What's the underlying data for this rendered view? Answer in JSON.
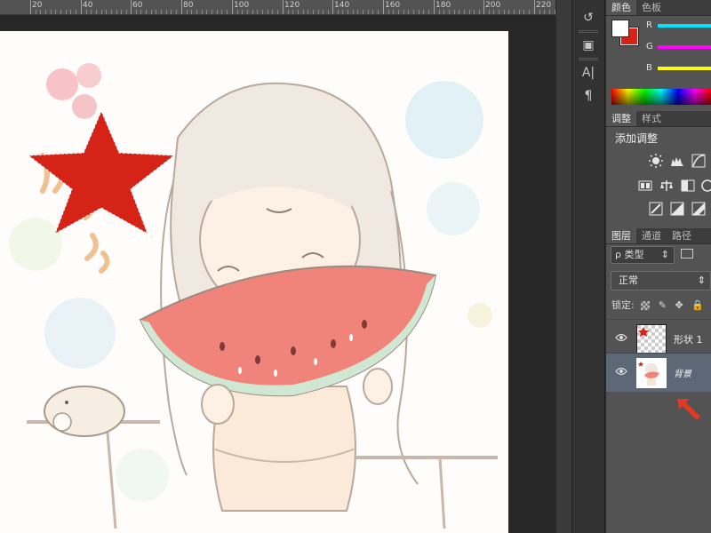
{
  "ruler": {
    "labels": [
      "20",
      "40",
      "60",
      "80",
      "100",
      "120",
      "140",
      "160",
      "180",
      "200",
      "220"
    ]
  },
  "canvas": {
    "star_color": "#d52318",
    "background": "#fffdfb"
  },
  "dock": {
    "items": [
      "history-icon",
      "3d-icon",
      "character-icon",
      "paragraph-icon"
    ],
    "glyphs": [
      "↺",
      "▣",
      "A|",
      "¶"
    ]
  },
  "color_panel": {
    "tabs": [
      "颜色",
      "色板"
    ],
    "sliders": [
      {
        "label": "R",
        "color": "#00e5ff"
      },
      {
        "label": "G",
        "color": "#ff00ff"
      },
      {
        "label": "B",
        "color": "#ffff00"
      }
    ],
    "foreground": "#ffffff",
    "background": "#d52318"
  },
  "adjustments": {
    "tabs": [
      "调整",
      "样式"
    ],
    "title": "添加调整"
  },
  "layers": {
    "tabs": [
      "图层",
      "通道",
      "路径"
    ],
    "kind_label": "ρ 类型",
    "blend_mode": "正常",
    "lock_label": "锁定:",
    "items": [
      {
        "name": "形状 1",
        "selected": false
      },
      {
        "name": "背景",
        "selected": true
      }
    ]
  },
  "accent": {
    "arrow": "#e03a24",
    "selection": "#5d6877"
  }
}
